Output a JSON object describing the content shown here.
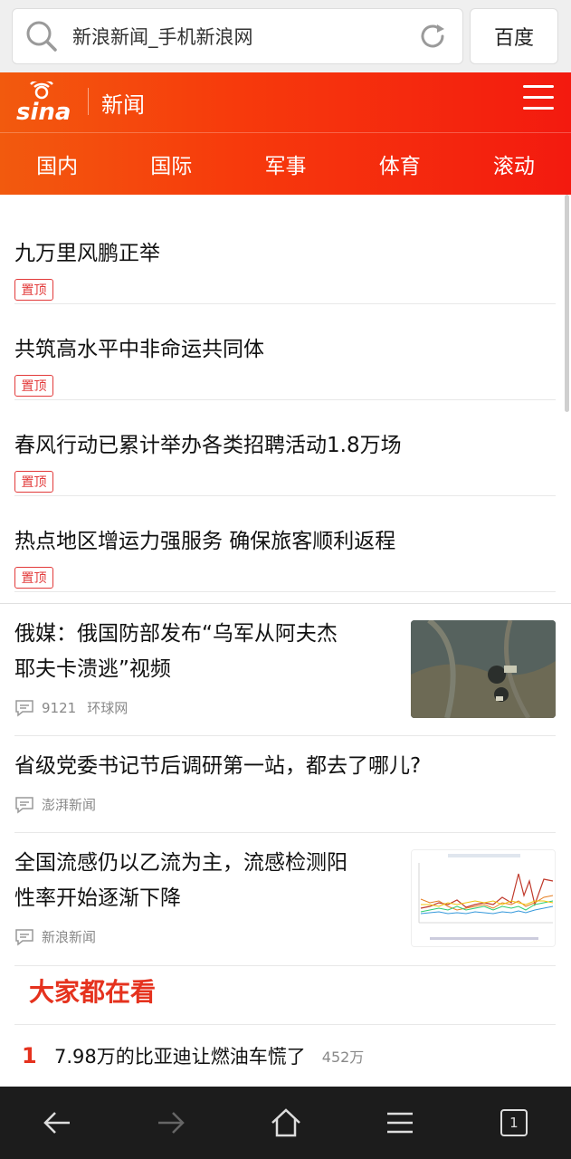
{
  "browser": {
    "url_title": "新浪新闻_手机新浪网",
    "baidu_label": "百度",
    "tab_count": "1"
  },
  "header": {
    "section_title": "新闻",
    "tabs": [
      "国内",
      "国际",
      "军事",
      "体育",
      "滚动"
    ]
  },
  "pinned": {
    "badge": "置顶",
    "items": [
      "九万里风鹏正举",
      "共筑高水平中非命运共同体",
      "春风行动已累计举办各类招聘活动1.8万场",
      "热点地区增运力强服务 确保旅客顺利返程"
    ]
  },
  "news": [
    {
      "title_line1": "俄媒：俄国防部发布“乌军从阿夫杰",
      "title_line2": "耶夫卡溃逃”视频",
      "comments": "9121",
      "source": "环球网"
    },
    {
      "title_line1": "省级党委书记节后调研第一站，都去了哪儿?",
      "source": "澎湃新闻"
    },
    {
      "title_line1": "全国流感仍以乙流为主，流感检测阳",
      "title_line2": "性率开始逐渐下降",
      "source": "新浪新闻"
    }
  ],
  "hot": {
    "heading": "大家都在看",
    "items": [
      {
        "rank": "1",
        "title": "7.98万的比亚迪让燃油车慌了",
        "count": "452万"
      }
    ]
  },
  "colors": {
    "brand_red": "#f31a0f",
    "brand_orange": "#f25a0e",
    "hot_red": "#e5321e"
  }
}
